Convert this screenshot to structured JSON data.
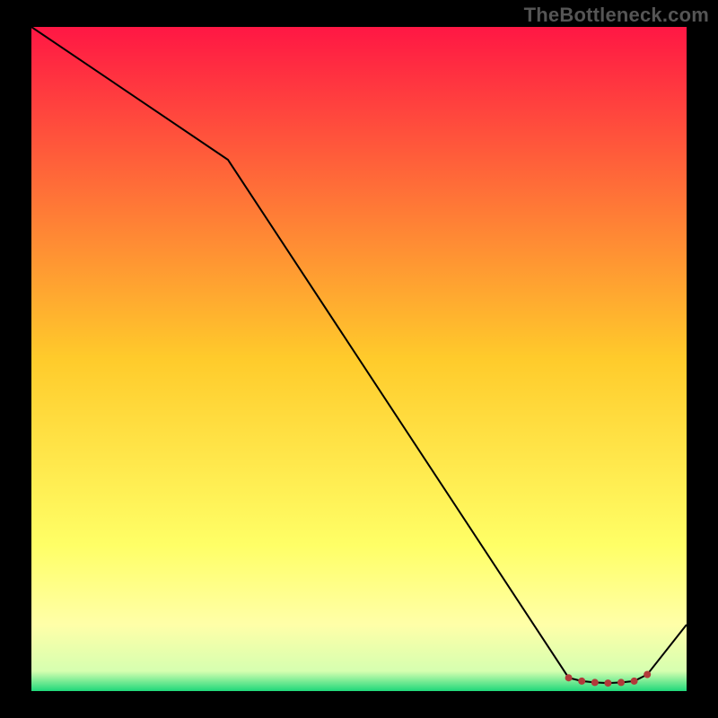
{
  "watermark": "TheBottleneck.com",
  "chart_data": {
    "type": "line",
    "title": "",
    "xlabel": "",
    "ylabel": "",
    "xlim": [
      0,
      100
    ],
    "ylim": [
      0,
      100
    ],
    "x": [
      0,
      30,
      82,
      84,
      86,
      88,
      90,
      92,
      94,
      100
    ],
    "values": [
      100,
      80,
      2,
      1.5,
      1.3,
      1.2,
      1.3,
      1.5,
      2.5,
      10
    ],
    "markers_x": [
      82,
      84,
      86,
      88,
      90,
      92,
      94
    ],
    "markers_y": [
      2,
      1.5,
      1.3,
      1.2,
      1.3,
      1.5,
      2.5
    ],
    "line_color": "#000000",
    "marker_color": "#b23a3a",
    "gradient_stops": [
      {
        "offset": 0.0,
        "color": "#ff1744"
      },
      {
        "offset": 0.5,
        "color": "#ffcb2b"
      },
      {
        "offset": 0.78,
        "color": "#ffff66"
      },
      {
        "offset": 0.9,
        "color": "#ffffa8"
      },
      {
        "offset": 0.97,
        "color": "#d6ffb0"
      },
      {
        "offset": 1.0,
        "color": "#1fd87a"
      }
    ]
  }
}
